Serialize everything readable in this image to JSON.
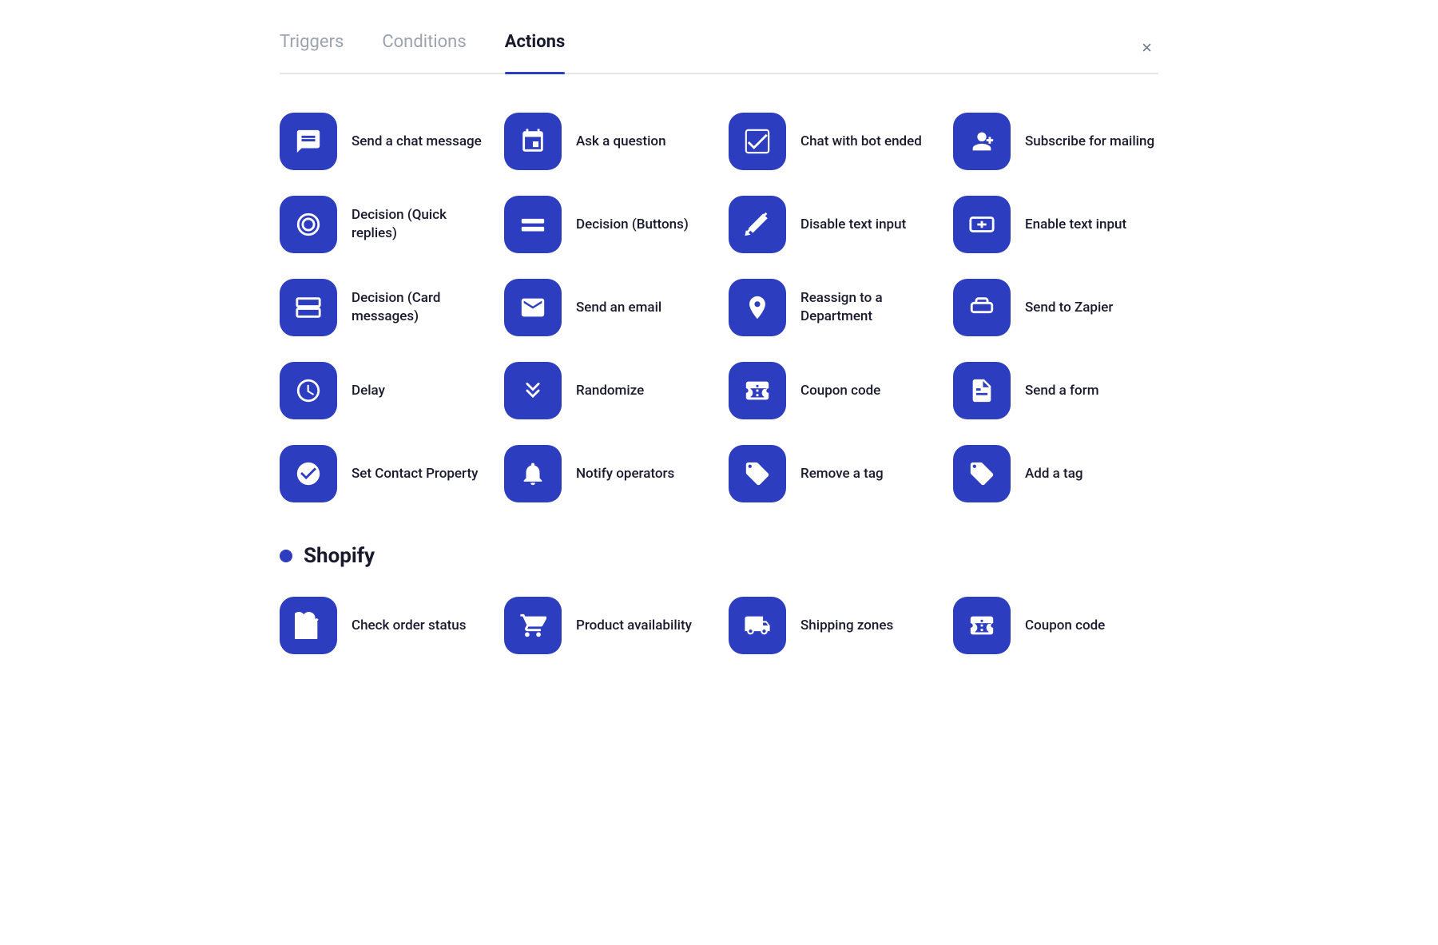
{
  "tabs": [
    {
      "id": "triggers",
      "label": "Triggers",
      "active": false
    },
    {
      "id": "conditions",
      "label": "Conditions",
      "active": false
    },
    {
      "id": "actions",
      "label": "Actions",
      "active": true
    }
  ],
  "close_label": "×",
  "actions": [
    {
      "id": "send-chat-message",
      "label": "Send a chat message",
      "icon": "chat"
    },
    {
      "id": "ask-question",
      "label": "Ask a question",
      "icon": "ask"
    },
    {
      "id": "chat-bot-ended",
      "label": "Chat with bot ended",
      "icon": "bot-ended"
    },
    {
      "id": "subscribe-mailing",
      "label": "Subscribe for mailing",
      "icon": "subscribe"
    },
    {
      "id": "decision-quick",
      "label": "Decision (Quick replies)",
      "icon": "quick-replies"
    },
    {
      "id": "decision-buttons",
      "label": "Decision (Buttons)",
      "icon": "buttons"
    },
    {
      "id": "disable-text",
      "label": "Disable text input",
      "icon": "disable-text"
    },
    {
      "id": "enable-text",
      "label": "Enable text input",
      "icon": "enable-text"
    },
    {
      "id": "decision-card",
      "label": "Decision (Card messages)",
      "icon": "card"
    },
    {
      "id": "send-email",
      "label": "Send an email",
      "icon": "email"
    },
    {
      "id": "reassign-dept",
      "label": "Reassign to a Department",
      "icon": "reassign"
    },
    {
      "id": "send-zapier",
      "label": "Send to Zapier",
      "icon": "zapier"
    },
    {
      "id": "delay",
      "label": "Delay",
      "icon": "delay"
    },
    {
      "id": "randomize",
      "label": "Randomize",
      "icon": "randomize"
    },
    {
      "id": "coupon-code",
      "label": "Coupon code",
      "icon": "coupon"
    },
    {
      "id": "send-form",
      "label": "Send a form",
      "icon": "form"
    },
    {
      "id": "set-contact",
      "label": "Set Contact Property",
      "icon": "contact"
    },
    {
      "id": "notify-operators",
      "label": "Notify operators",
      "icon": "notify"
    },
    {
      "id": "remove-tag",
      "label": "Remove a tag",
      "icon": "tag"
    },
    {
      "id": "add-tag",
      "label": "Add a tag",
      "icon": "tag-add"
    }
  ],
  "shopify": {
    "title": "Shopify",
    "items": [
      {
        "id": "check-order",
        "label": "Check order status",
        "icon": "order"
      },
      {
        "id": "product-availability",
        "label": "Product availability",
        "icon": "cart"
      },
      {
        "id": "shipping-zones",
        "label": "Shipping zones",
        "icon": "shipping"
      },
      {
        "id": "shopify-coupon",
        "label": "Coupon code",
        "icon": "coupon"
      }
    ]
  }
}
